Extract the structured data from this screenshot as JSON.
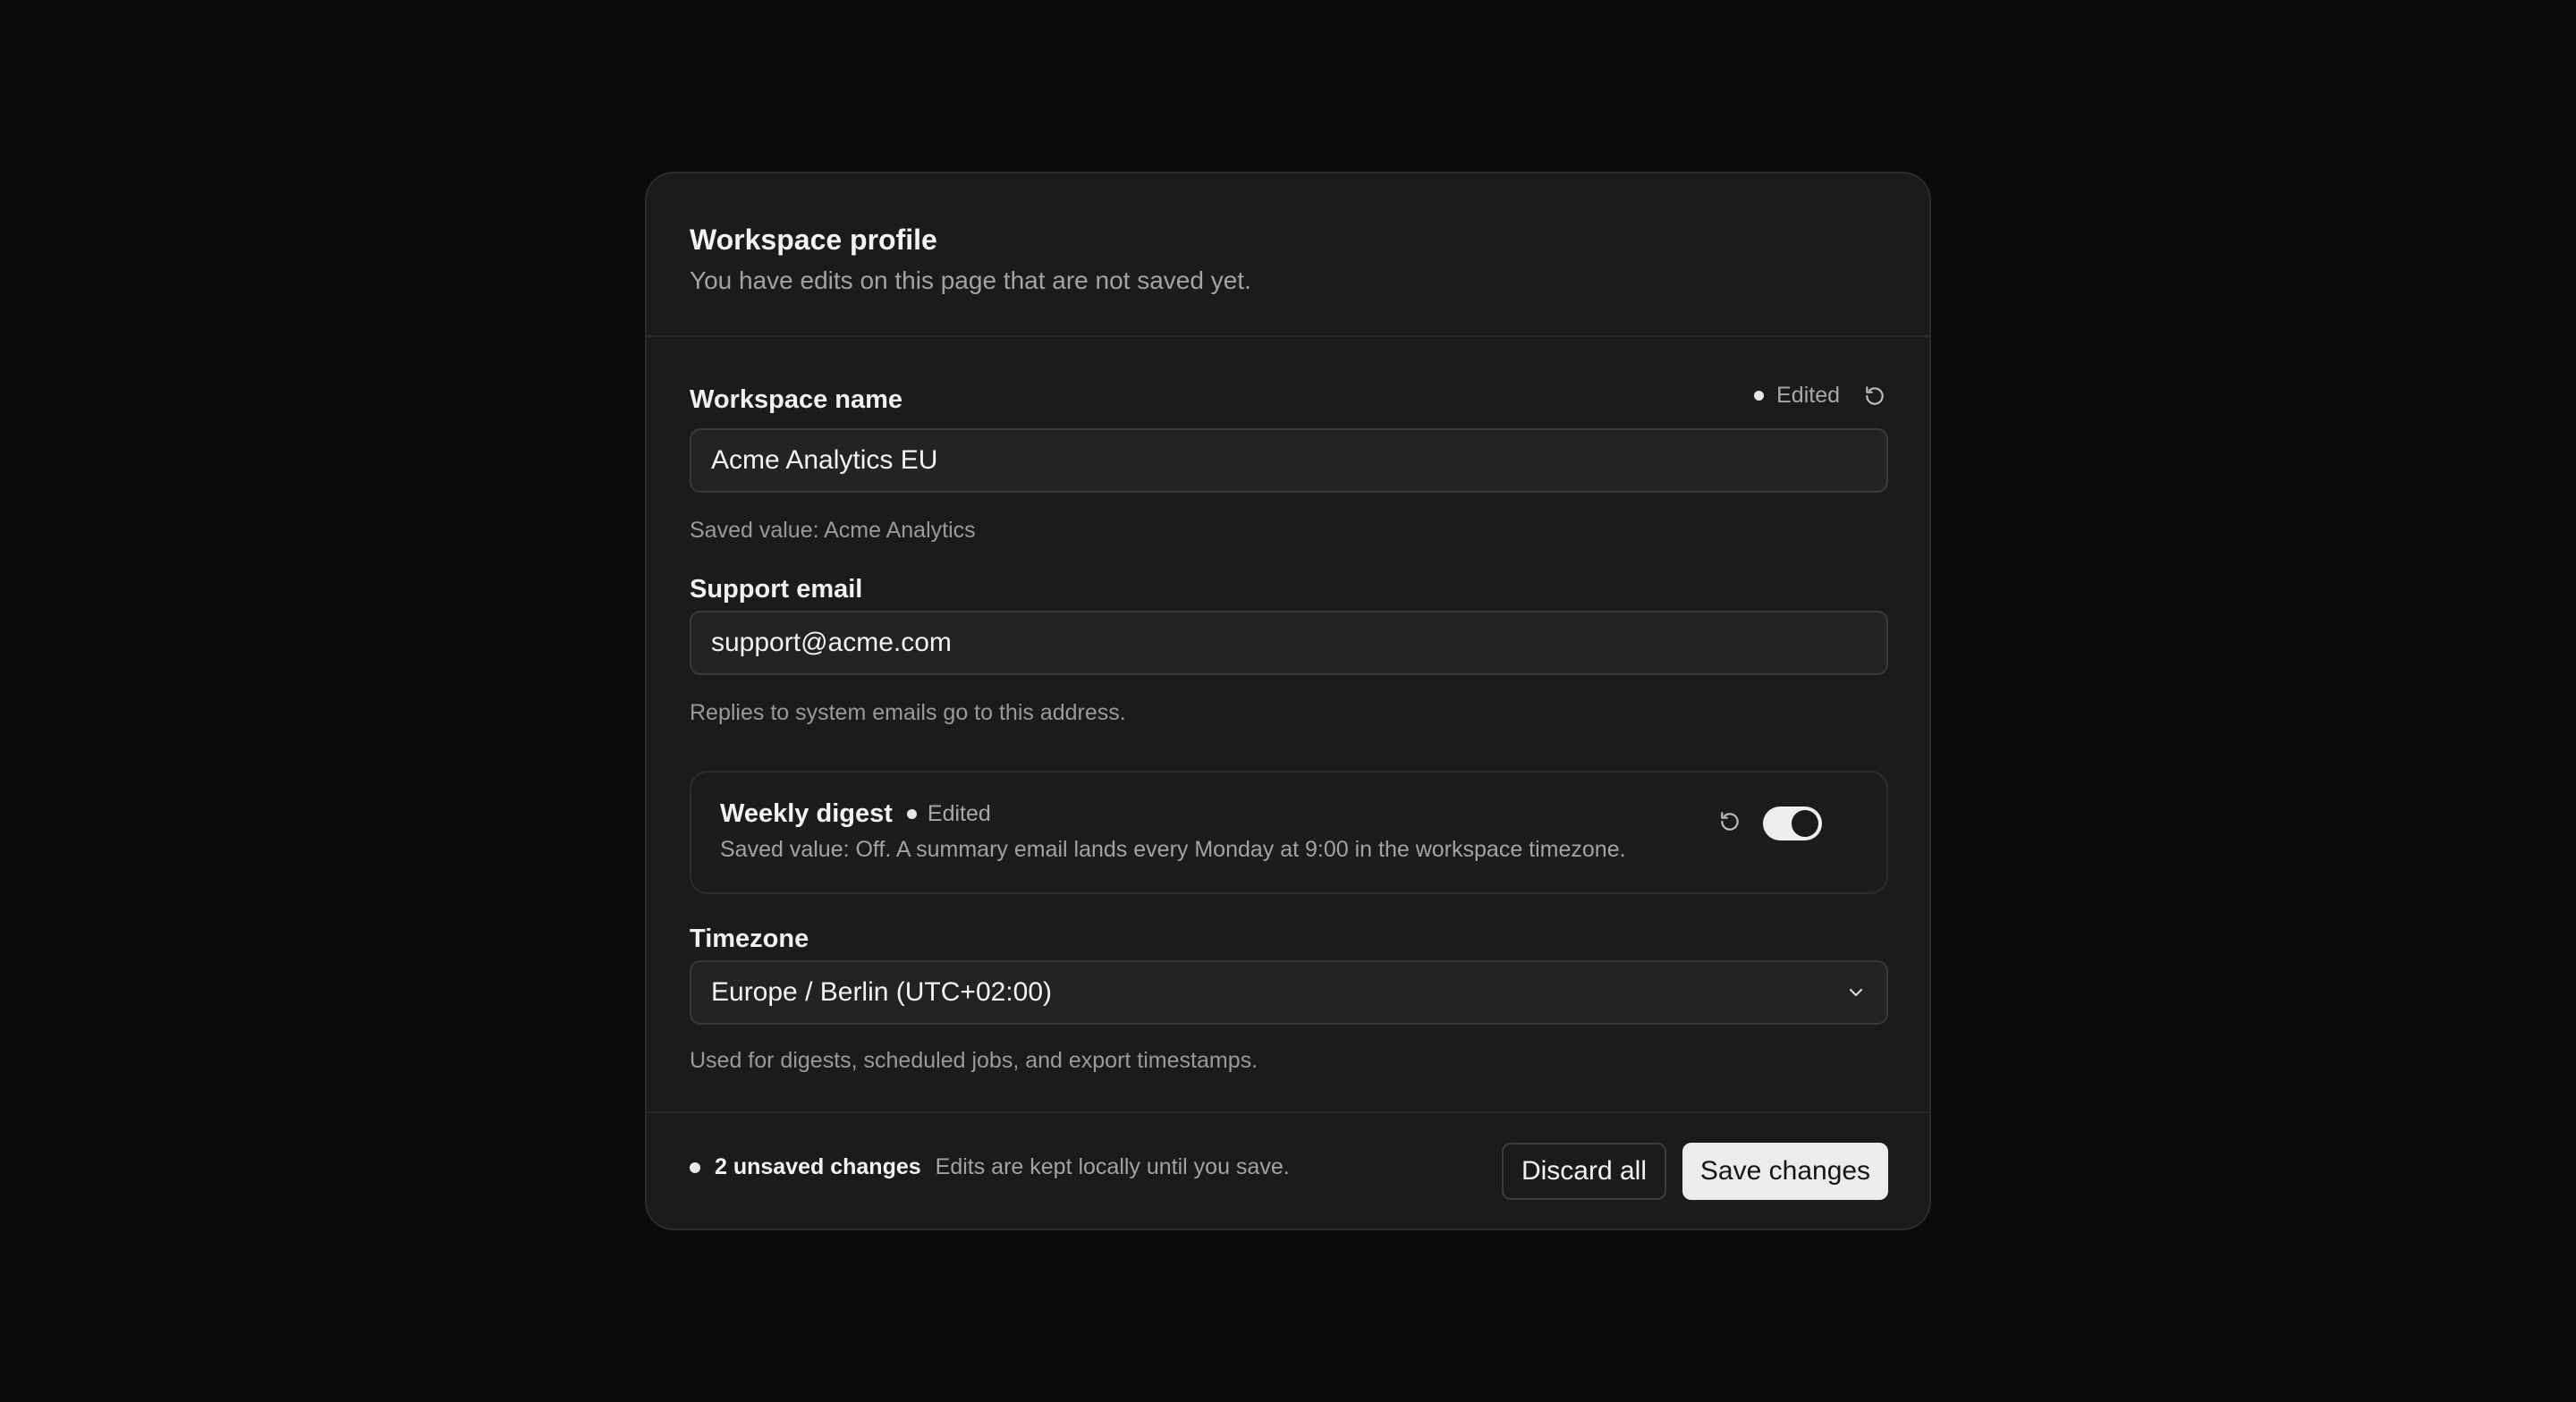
{
  "header": {
    "title": "Workspace profile",
    "subtitle": "You have edits on this page that are not saved yet."
  },
  "workspace_name": {
    "label": "Workspace name",
    "edited_label": "Edited",
    "value": "Acme Analytics EU",
    "hint": "Saved value: Acme Analytics"
  },
  "support_email": {
    "label": "Support email",
    "value": "support@acme.com",
    "hint": "Replies to system emails go to this address."
  },
  "weekly_digest": {
    "title": "Weekly digest",
    "edited_label": "Edited",
    "description": "Saved value: Off. A summary email lands every Monday at 9:00 in the workspace timezone.",
    "enabled": true
  },
  "timezone": {
    "label": "Timezone",
    "selected": "Europe / Berlin (UTC+02:00)",
    "hint": "Used for digests, scheduled jobs, and export timestamps."
  },
  "footer": {
    "unsaved_count": "2 unsaved changes",
    "note": "Edits are kept locally until you save.",
    "discard_label": "Discard all",
    "save_label": "Save changes"
  },
  "icons": {
    "reset": "reset-icon",
    "chevron": "chevron-down-icon"
  },
  "colors": {
    "background": "#0b0b0c",
    "card": "#1b1b1c",
    "accent": "#ececed"
  }
}
